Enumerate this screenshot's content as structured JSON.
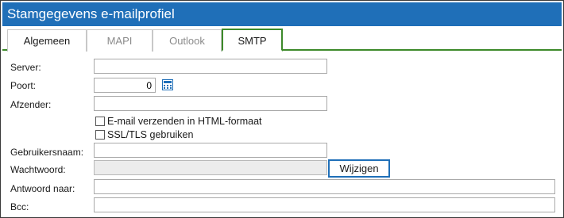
{
  "window": {
    "title": "Stamgegevens e-mailprofiel"
  },
  "tabs": [
    {
      "label": "Algemeen"
    },
    {
      "label": "MAPI"
    },
    {
      "label": "Outlook"
    },
    {
      "label": "SMTP"
    }
  ],
  "active_tab": "SMTP",
  "form": {
    "server": {
      "label": "Server:",
      "value": ""
    },
    "poort": {
      "label": "Poort:",
      "value": "0",
      "icon": "calculator-icon"
    },
    "afzender": {
      "label": "Afzender:",
      "value": ""
    },
    "html_checkbox": {
      "label": "E-mail verzenden in HTML-formaat",
      "checked": false
    },
    "ssl_checkbox": {
      "label": "SSL/TLS gebruiken",
      "checked": false
    },
    "gebruikersnaam": {
      "label": "Gebruikersnaam:",
      "value": ""
    },
    "wachtwoord": {
      "label": "Wachtwoord:",
      "value": "",
      "button_label": "Wijzigen"
    },
    "antwoord_naar": {
      "label": "Antwoord naar:",
      "value": ""
    },
    "bcc": {
      "label": "Bcc:",
      "value": ""
    }
  },
  "colors": {
    "titlebar": "#1f6fb8",
    "active_tab_border": "#3d8a2a",
    "focus_button_border": "#1f6fb8"
  }
}
